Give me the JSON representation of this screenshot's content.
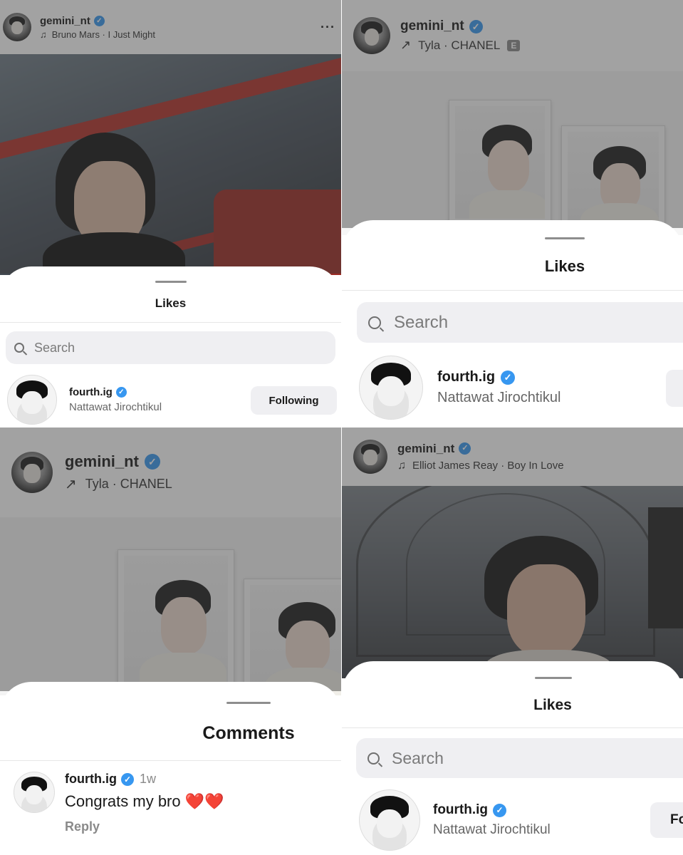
{
  "panels": [
    {
      "username": "gemini_nt",
      "subtitle": "Bruno Mars · I Just Might",
      "subtitle_icon": "music-note-icon",
      "more": "···",
      "sheet": {
        "title": "Likes",
        "search_placeholder": "Search",
        "user": {
          "username": "fourth.ig",
          "full_name": "Nattawat Jirochtikul",
          "button": "Following"
        }
      }
    },
    {
      "username": "gemini_nt",
      "subtitle": "Tyla · CHANEL",
      "subtitle_icon": "arrow-up-right-icon",
      "explicit_badge": "E",
      "sheet": {
        "title": "Likes",
        "search_placeholder": "Search",
        "user": {
          "username": "fourth.ig",
          "full_name": "Nattawat Jirochtikul",
          "button": ""
        }
      }
    },
    {
      "username": "gemini_nt",
      "subtitle": "Tyla · CHANEL",
      "subtitle_icon": "arrow-up-right-icon",
      "sheet": {
        "title": "Comments",
        "comment": {
          "username": "fourth.ig",
          "time": "1w",
          "text": "Congrats my bro ❤️❤️",
          "reply": "Reply"
        }
      }
    },
    {
      "username": "gemini_nt",
      "subtitle": "Elliot James Reay · Boy In Love",
      "subtitle_icon": "music-note-icon",
      "sheet": {
        "title": "Likes",
        "search_placeholder": "Search",
        "user": {
          "username": "fourth.ig",
          "full_name": "Nattawat Jirochtikul",
          "button": "Fo"
        }
      }
    }
  ],
  "colors": {
    "verified": "#3797f0",
    "button_bg": "#efeff2",
    "dim_overlay": "rgba(60,60,60,0.48)",
    "heart": "#e0242f"
  }
}
